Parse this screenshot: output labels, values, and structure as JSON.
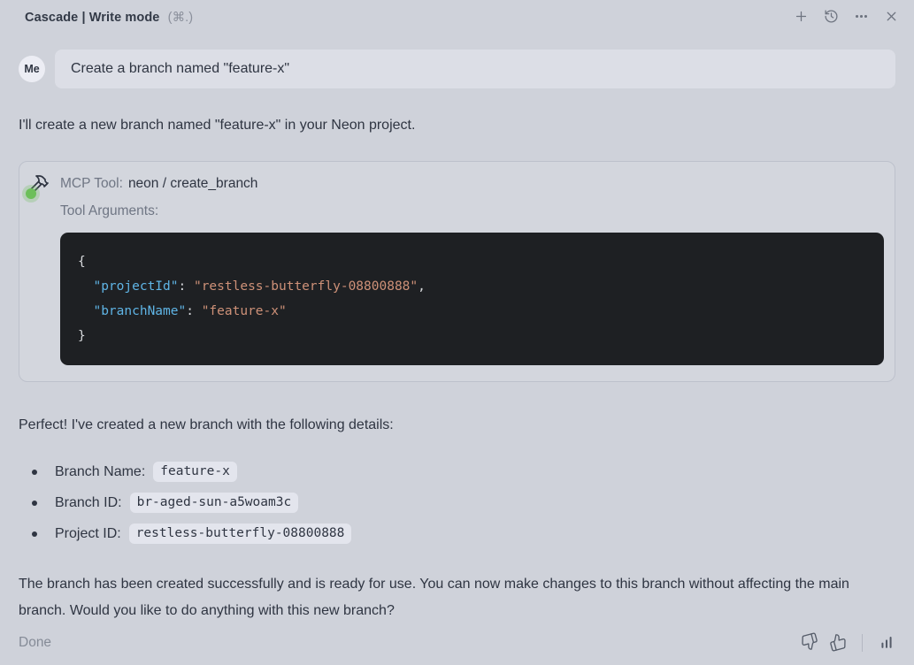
{
  "header": {
    "title": "Cascade | Write mode",
    "shortcut": "(⌘.)",
    "actions": [
      {
        "name": "new-conversation",
        "icon": "plus-icon"
      },
      {
        "name": "history",
        "icon": "history-icon"
      },
      {
        "name": "more-options",
        "icon": "ellipsis-icon"
      },
      {
        "name": "close",
        "icon": "close-icon"
      }
    ]
  },
  "user_message": {
    "avatar": "Me",
    "text": "Create a branch named \"feature-x\""
  },
  "assistant": {
    "intro": "I'll create a new branch named \"feature-x\" in your Neon project.",
    "tool_card": {
      "label": "MCP Tool:",
      "tool_name": "neon / create_branch",
      "arguments_label": "Tool Arguments:",
      "icon": "hammer-icon",
      "status": "success",
      "code": {
        "language": "json",
        "lines": [
          [
            {
              "t": "{",
              "c": "punct"
            }
          ],
          [
            {
              "t": "  ",
              "c": "punct"
            },
            {
              "t": "\"projectId\"",
              "c": "key"
            },
            {
              "t": ": ",
              "c": "punct"
            },
            {
              "t": "\"restless-butterfly-08800888\"",
              "c": "string"
            },
            {
              "t": ",",
              "c": "punct"
            }
          ],
          [
            {
              "t": "  ",
              "c": "punct"
            },
            {
              "t": "\"branchName\"",
              "c": "key"
            },
            {
              "t": ": ",
              "c": "punct"
            },
            {
              "t": "\"feature-x\"",
              "c": "string"
            }
          ],
          [
            {
              "t": "}",
              "c": "punct"
            }
          ]
        ]
      }
    },
    "result_intro": "Perfect! I've created a new branch with the following details:",
    "details": [
      {
        "label": "Branch Name:",
        "value": "feature-x"
      },
      {
        "label": "Branch ID:",
        "value": "br-aged-sun-a5woam3c"
      },
      {
        "label": "Project ID:",
        "value": "restless-butterfly-08800888"
      }
    ],
    "closing": "The branch has been created successfully and is ready for use. You can now make changes to this branch without affecting the main branch. Would you like to do anything with this new branch?"
  },
  "footer": {
    "status": "Done",
    "actions": [
      {
        "name": "thumbs-down",
        "icon": "thumbs-down-icon"
      },
      {
        "name": "thumbs-up",
        "icon": "thumbs-up-icon"
      },
      {
        "name": "usage-stats",
        "icon": "bar-chart-icon"
      }
    ]
  },
  "colors": {
    "background": "#cfd2da",
    "bubble": "#dcdee6",
    "card_border": "#bdc1cc",
    "code_background": "#1e2023",
    "chip_background": "#e3e5ed",
    "status_green": "#6cbf5a",
    "syntax": {
      "key": "#5fb4e5",
      "string": "#ce9178",
      "punct": "#d7d9dc"
    }
  }
}
